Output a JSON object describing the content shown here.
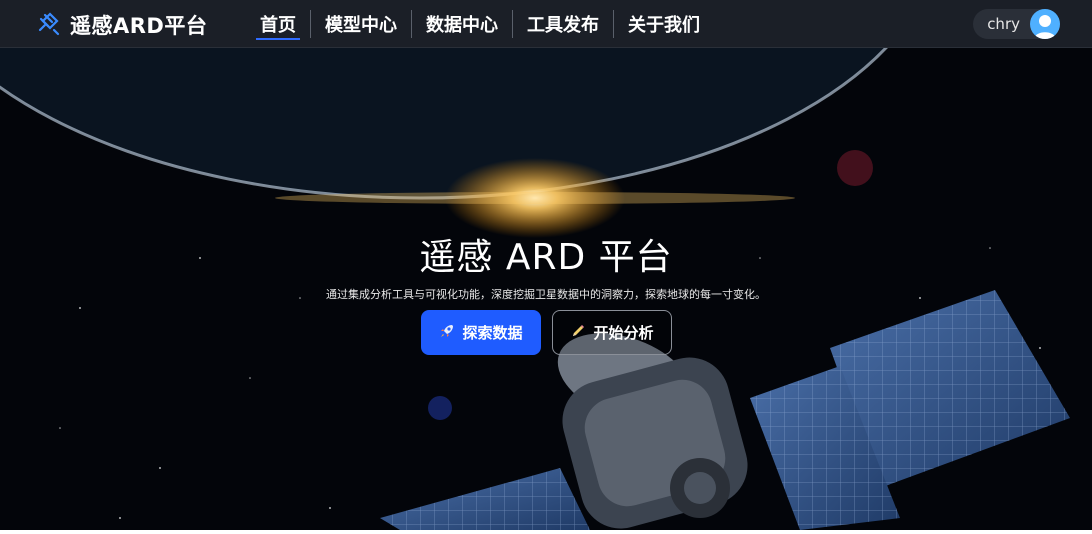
{
  "header": {
    "logo_text": "遥感ARD平台",
    "logo_icon": "satellite-logo-icon",
    "nav": [
      {
        "label": "首页",
        "active": true
      },
      {
        "label": "模型中心",
        "active": false
      },
      {
        "label": "数据中心",
        "active": false
      },
      {
        "label": "工具发布",
        "active": false
      },
      {
        "label": "关于我们",
        "active": false
      }
    ],
    "user_name": "chry",
    "avatar_icon": "user-avatar-icon"
  },
  "hero": {
    "title": "遥感 ARD 平台",
    "subtitle": "通过集成分析工具与可视化功能，深度挖掘卫星数据中的洞察力，探索地球的每一寸变化。",
    "primary_button": {
      "label": "探索数据",
      "icon": "rocket-icon"
    },
    "secondary_button": {
      "label": "开始分析",
      "icon": "pencil-icon"
    }
  },
  "colors": {
    "header_bg": "#1b1f27",
    "accent": "#1f5cff",
    "avatar": "#4fb0ff"
  }
}
